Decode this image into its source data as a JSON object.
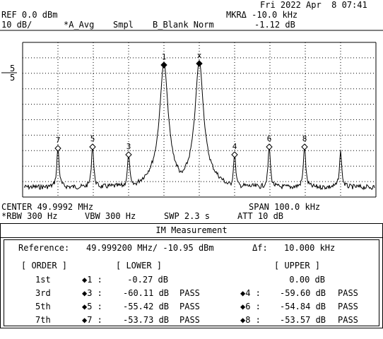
{
  "header": {
    "datetime": "Fri 2022 Apr  8 07:41",
    "ref_level": "REF 0.0 dBm",
    "marker_label": "MKRΔ -10.0 kHz",
    "scale": "10 dB/",
    "trace_a": "*A_Avg",
    "detector": "Smpl",
    "trace_b": "B_Blank Norm",
    "marker_value": "-1.12 dB",
    "left_tick_top": "5",
    "left_tick_bottom": "5"
  },
  "trace": {
    "markers": [
      {
        "label": "1",
        "symbol": "diamond"
      },
      {
        "label": "x",
        "symbol": "reference"
      },
      {
        "label": "3",
        "symbol": "diamond"
      },
      {
        "label": "4",
        "symbol": "diamond"
      },
      {
        "label": "5",
        "symbol": "diamond"
      },
      {
        "label": "6",
        "symbol": "diamond"
      },
      {
        "label": "7",
        "symbol": "diamond"
      },
      {
        "label": "8",
        "symbol": "diamond"
      }
    ]
  },
  "footer": {
    "center": "CENTER 49.9992 MHz",
    "span": "SPAN 100.0 kHz",
    "rbw": "*RBW 300 Hz",
    "vbw": "VBW 300 Hz",
    "sweep": "SWP 2.3 s",
    "att": "ATT 10 dB"
  },
  "im": {
    "title": "IM Measurement",
    "reference_label": "Reference:",
    "reference_value": "49.999200 MHz/ -10.95 dBm",
    "delta_label": "Δf:",
    "delta_value": "10.000 kHz",
    "order_header": "[ ORDER ]",
    "lower_header": "[ LOWER ]",
    "upper_header": "[ UPPER ]",
    "rows": [
      {
        "order": "1st",
        "lower_marker": "◆1 :",
        "lower_value": "-0.27 dB",
        "lower_status": "",
        "upper_marker": "",
        "upper_value": "0.00 dB",
        "upper_status": ""
      },
      {
        "order": "3rd",
        "lower_marker": "◆3 :",
        "lower_value": "-60.11 dB",
        "lower_status": "PASS",
        "upper_marker": "◆4 :",
        "upper_value": "-59.60 dB",
        "upper_status": "PASS"
      },
      {
        "order": "5th",
        "lower_marker": "◆5 :",
        "lower_value": "-55.42 dB",
        "lower_status": "PASS",
        "upper_marker": "◆6 :",
        "upper_value": "-54.84 dB",
        "upper_status": "PASS"
      },
      {
        "order": "7th",
        "lower_marker": "◆7 :",
        "lower_value": "-53.73 dB",
        "lower_status": "PASS",
        "upper_marker": "◆8 :",
        "upper_value": "-53.57 dB",
        "upper_status": "PASS"
      }
    ]
  }
}
